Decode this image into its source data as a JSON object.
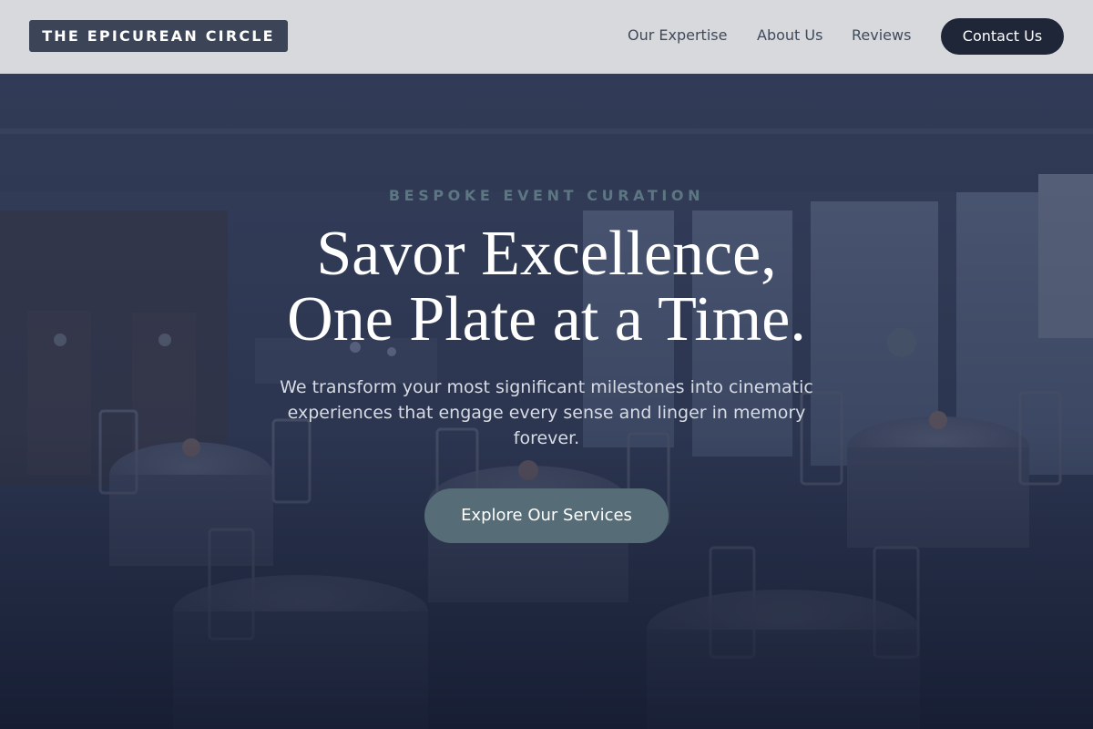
{
  "header": {
    "logo": "THE EPICUREAN CIRCLE",
    "nav": [
      {
        "label": "Our Expertise"
      },
      {
        "label": "About Us"
      },
      {
        "label": "Reviews"
      }
    ],
    "contact_label": "Contact Us"
  },
  "hero": {
    "eyebrow": "BESPOKE EVENT CURATION",
    "title_line1": "Savor Excellence,",
    "title_line2": "One Plate at a Time.",
    "subtitle": "We transform your most significant milestones into cinematic experiences that engage every sense and linger in memory forever.",
    "cta_label": "Explore Our Services"
  },
  "colors": {
    "header_bg": "#d8d9dd",
    "logo_bg": "#3b4557",
    "contact_bg": "#1e2638",
    "eyebrow": "#5d7683",
    "cta_bg": "#566c77"
  }
}
